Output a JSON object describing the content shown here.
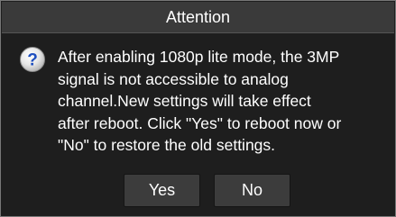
{
  "dialog": {
    "title": "Attention",
    "icon": "question-icon",
    "message": "After enabling 1080p lite mode, the 3MP\nsignal is not accessible to analog\nchannel.New settings will take effect\nafter reboot. Click \"Yes\" to reboot now or\n\"No\" to restore the old settings.",
    "yes_label": "Yes",
    "no_label": "No"
  },
  "colors": {
    "background": "#1e1e1e",
    "title_bar": "#3a3a3a",
    "button": "#3c3c3c",
    "icon_blue": "#1f4fbf",
    "text": "#ffffff"
  }
}
